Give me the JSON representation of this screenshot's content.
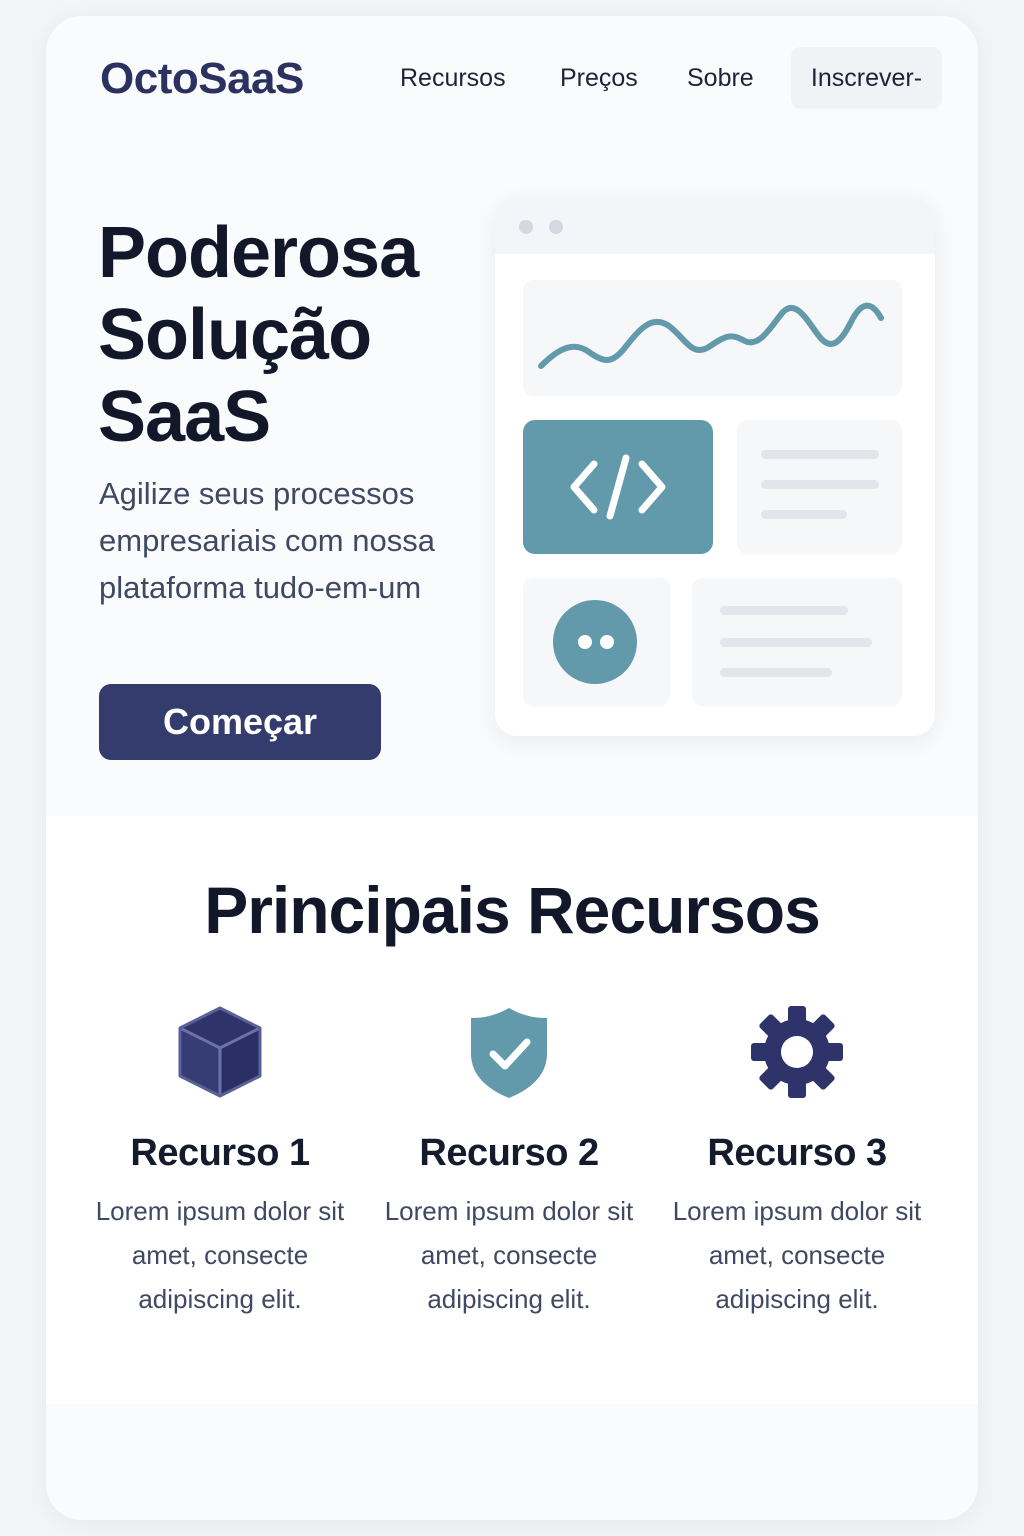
{
  "brand": {
    "logo": "OctoSaaS"
  },
  "nav": {
    "links": [
      "Recursos",
      "Preços",
      "Sobre"
    ],
    "signup_label": "Inscrever-"
  },
  "hero": {
    "title_lines": [
      "Poderosa",
      "Solução",
      "SaaS"
    ],
    "subtitle": "Agilize seus processos empresariais com nossa plataforma tudo-em-um",
    "cta_label": "Começar"
  },
  "mockup": {
    "icons": [
      "code-icon",
      "chat-bubble-icon",
      "wave-chart-icon"
    ]
  },
  "features": {
    "title": "Principais Recursos",
    "items": [
      {
        "icon": "cube-icon",
        "title": "Recurso 1",
        "description": "Lorem ipsum dolor sit amet, consecte adipiscing elit."
      },
      {
        "icon": "shield-check-icon",
        "title": "Recurso 2",
        "description": "Lorem ipsum dolor sit amet, consecte adipiscing elit."
      },
      {
        "icon": "gear-icon",
        "title": "Recurso 3",
        "description": "Lorem ipsum dolor sit amet, consecte adipiscing elit."
      }
    ]
  },
  "colors": {
    "primary": "#343b6d",
    "accent": "#629aab",
    "text": "#121829",
    "muted": "#3f4962"
  }
}
